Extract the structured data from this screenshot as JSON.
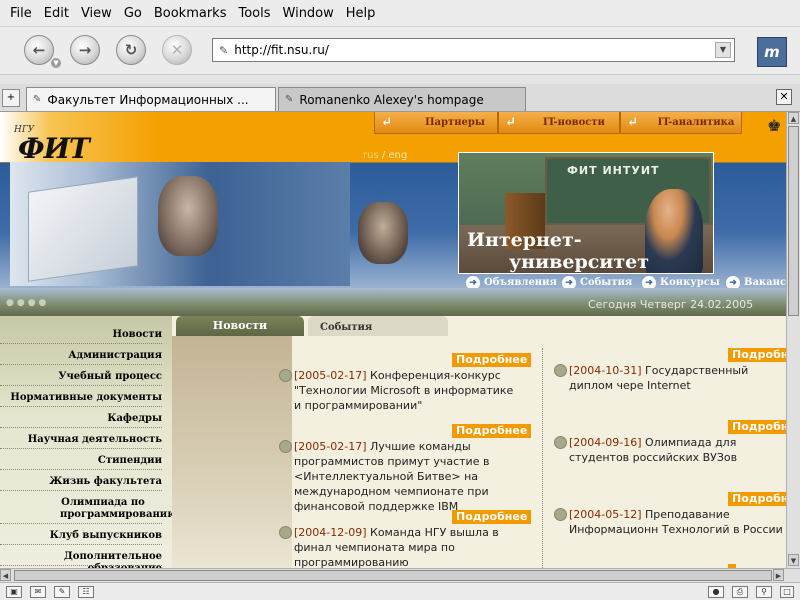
{
  "menu": [
    "File",
    "Edit",
    "View",
    "Go",
    "Bookmarks",
    "Tools",
    "Window",
    "Help"
  ],
  "url": "http://fit.nsu.ru/",
  "tabs": [
    "Факультет Информационных ...",
    "Romanenko Alexey's hompage"
  ],
  "site": {
    "logo_sub": "НГУ",
    "logo_main": "ФИТ",
    "lang_rus": "rus",
    "lang_sep": " / ",
    "lang_eng": "eng",
    "top_nav": [
      "Партнеры",
      "IT-новости",
      "IT-аналитика"
    ],
    "intuit_caption": "ФИТ ИНТУИТ",
    "intuit_line1": "Интернет-",
    "intuit_line2": "университет",
    "blue_nav": [
      "Объявления",
      "События",
      "Конкурсы",
      "Ваканси"
    ],
    "date": "Сегодня Четверг 24.02.2005",
    "sidebar": [
      "Новости",
      "Администрация",
      "Учебный процесс",
      "Нормативные документы",
      "Кафедры",
      "Научная деятельность",
      "Стипендии",
      "Жизнь факультета",
      "Олимпиада по программированию",
      "Клуб выпускников",
      "Дополнительное образование"
    ],
    "tab_news": "Новости",
    "tab_events": "События",
    "more_label": "Подробнее",
    "news_left": [
      {
        "date": "[2005-02-17]",
        "text": " Конференция-конкурс \"Технологии Microsoft в информатике и программировании\""
      },
      {
        "date": "[2005-02-17]",
        "text": " Лучшие команды программистов примут участие в <Интеллектуальной Битве> на международном чемпионате при финансовой поддержке IBM"
      },
      {
        "date": "[2004-12-09]",
        "text": " Команда НГУ вышла в финал чемпионата мира по программированию"
      }
    ],
    "news_right": [
      {
        "date": "[2004-10-31]",
        "text": " Государственный диплом чере Internet"
      },
      {
        "date": "[2004-09-16]",
        "text": " Олимпиада для студентов российских ВУЗов"
      },
      {
        "date": "[2004-05-12]",
        "text": " Преподавание Информационн Технологий в России"
      }
    ]
  }
}
